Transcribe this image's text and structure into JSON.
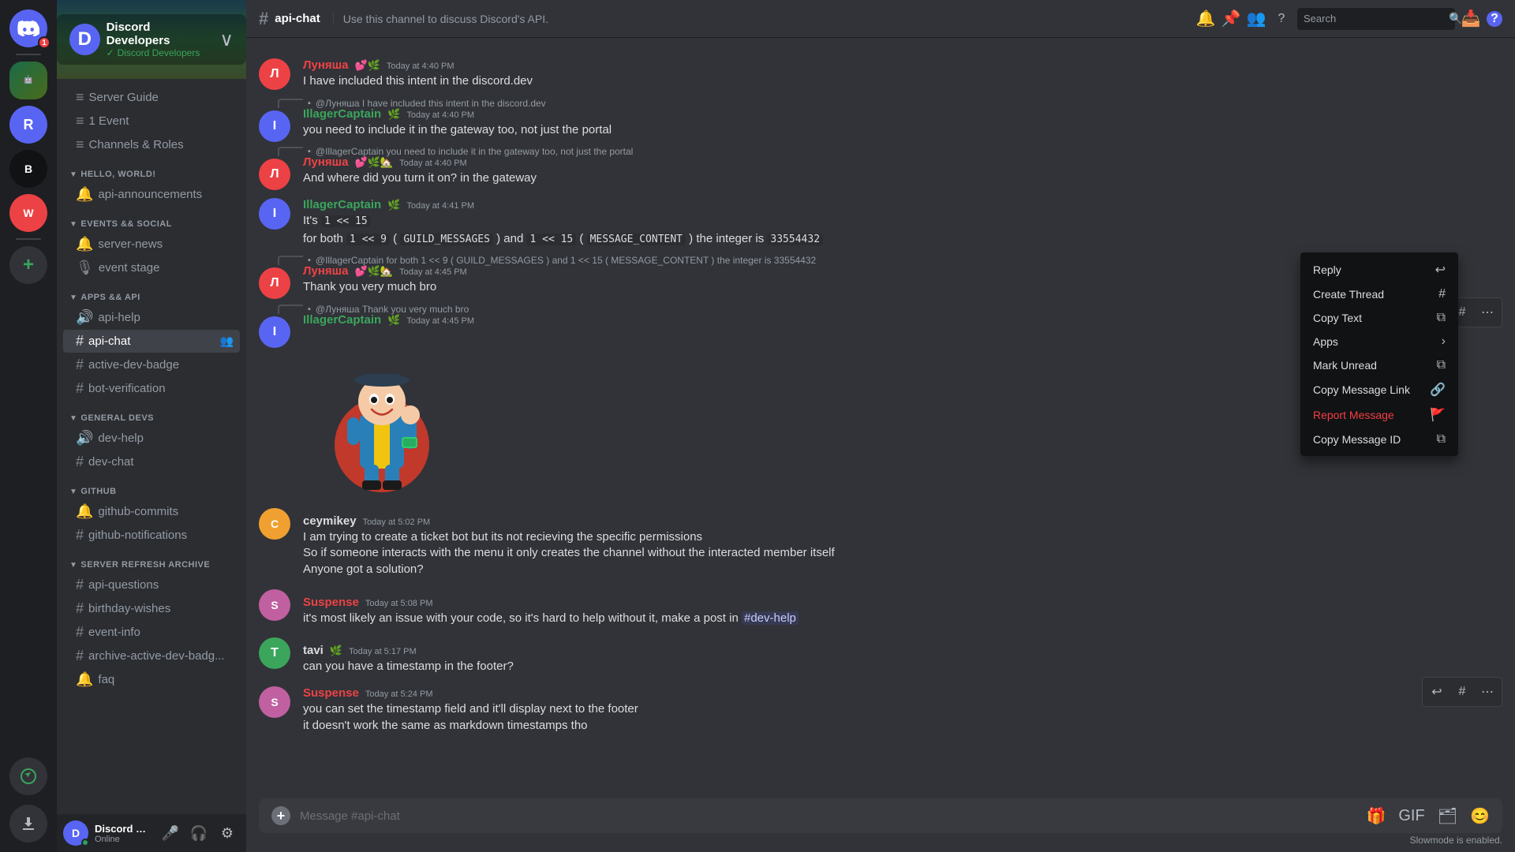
{
  "server": {
    "name": "Discord Developers",
    "banner_gradient": "linear-gradient(135deg, #5865f2, #3ba55c)"
  },
  "channel": {
    "name": "api-chat",
    "hash": "#",
    "topic": "Use this channel to discuss Discord's API.",
    "input_placeholder": "Message #api-chat"
  },
  "sidebar": {
    "categories": [
      {
        "name": "HELLO, WORLD!",
        "channels": [
          {
            "type": "announce",
            "name": "api-announcements",
            "active": false
          }
        ]
      },
      {
        "name": "EVENTS && SOCIAL",
        "channels": [
          {
            "type": "text",
            "name": "server-news",
            "active": false
          },
          {
            "type": "stage",
            "name": "event stage",
            "active": false
          }
        ]
      },
      {
        "name": "APPS && API",
        "channels": [
          {
            "type": "text",
            "name": "api-help",
            "active": false
          },
          {
            "type": "hash",
            "name": "api-chat",
            "active": true
          },
          {
            "type": "hash",
            "name": "active-dev-badge",
            "active": false
          },
          {
            "type": "hash",
            "name": "bot-verification",
            "active": false
          }
        ]
      },
      {
        "name": "GENERAL DEVS",
        "channels": [
          {
            "type": "text",
            "name": "dev-help",
            "active": false
          },
          {
            "type": "hash",
            "name": "dev-chat",
            "active": false
          }
        ]
      },
      {
        "name": "GITHUB",
        "channels": [
          {
            "type": "announce",
            "name": "github-commits",
            "active": false
          },
          {
            "type": "hash",
            "name": "github-notifications",
            "active": false
          }
        ]
      },
      {
        "name": "SERVER REFRESH ARCHIVE",
        "channels": [
          {
            "type": "hash",
            "name": "api-questions",
            "active": false
          },
          {
            "type": "hash",
            "name": "birthday-wishes",
            "active": false
          },
          {
            "type": "hash",
            "name": "event-info",
            "active": false
          },
          {
            "type": "hash",
            "name": "archive-active-dev-badg...",
            "active": false
          },
          {
            "type": "announce",
            "name": "faq",
            "active": false
          }
        ]
      }
    ]
  },
  "messages": [
    {
      "id": "msg1",
      "avatar_color": "#3ba55c",
      "avatar_letter": "Л",
      "author": "Луняша",
      "author_color": "#ed4245",
      "badges": "💕🌿",
      "timestamp": "Today at 4:40 PM",
      "content": "I have included this intent in the discord.dev",
      "has_reply": false
    },
    {
      "id": "msg2",
      "avatar_color": "#5865f2",
      "avatar_letter": "I",
      "author": "IllagerCaptain",
      "author_color": "#3ba55c",
      "badges": "🌿",
      "timestamp": "Today at 4:40 PM",
      "has_reply": true,
      "reply_to": "@Луняша",
      "reply_content": "I have included this intent in the discord.dev",
      "content": "you need to include it in the gateway too, not just the portal"
    },
    {
      "id": "msg3",
      "avatar_color": "#ed4245",
      "avatar_letter": "Л",
      "author": "Луняша",
      "author_color": "#ed4245",
      "badges": "💕🌿🏡",
      "timestamp": "Today at 4:40 PM",
      "has_reply": true,
      "reply_to": "@IllagerCaptain",
      "reply_content": "you need to include it in the gateway too, not just the portal",
      "content": "And where did you turn it on? in the gateway"
    },
    {
      "id": "msg4",
      "avatar_color": "#5865f2",
      "avatar_letter": "I",
      "author": "IllagerCaptain",
      "author_color": "#3ba55c",
      "badges": "🌿",
      "timestamp": "Today at 4:41 PM",
      "has_reply": false,
      "content": "It's  1 << 15",
      "content2": "for both  1 << 9 ( GUILD_MESSAGES ) and  1 << 15 ( MESSAGE_CONTENT ) the integer is  33554432",
      "has_image": false
    },
    {
      "id": "msg5",
      "avatar_color": "#ed4245",
      "avatar_letter": "Л",
      "author": "Луняша",
      "author_color": "#ed4245",
      "badges": "💕🌿🏡",
      "timestamp": "Today at 4:45 PM",
      "has_reply": true,
      "reply_to": "@IllagerCaptain",
      "reply_content": "for both  1 << 9 ( GUILD_MESSAGES ) and  1 << 15 ( MESSAGE_CONTENT ) the integer is  33554432",
      "content": "Thank you very much bro"
    },
    {
      "id": "msg6",
      "avatar_color": "#5865f2",
      "avatar_letter": "I",
      "author": "IllagerCaptain",
      "author_color": "#3ba55c",
      "badges": "🌿",
      "timestamp": "Today at 4:45 PM",
      "has_reply": true,
      "reply_to": "@Луняша",
      "reply_content": "Thank you very much bro",
      "content": "",
      "has_image": true
    },
    {
      "id": "msg7",
      "avatar_color": "#f0c060",
      "avatar_letter": "C",
      "author": "ceymikey",
      "author_color": "#dcddde",
      "badges": "",
      "timestamp": "Today at 5:02 PM",
      "has_reply": false,
      "content": "I am trying to create a ticket bot but its not recieving the specific permissions\nSo if someone interacts with the menu it only creates the channel without the interacted member itself\nAnyone got a solution?"
    },
    {
      "id": "msg8",
      "avatar_color": "#c060a0",
      "avatar_letter": "S",
      "author": "Suspense",
      "author_color": "#ed4245",
      "badges": "",
      "timestamp": "Today at 5:08 PM",
      "has_reply": false,
      "content": "it's most likely an issue with your code, so it's hard to help without it, make a post in #dev-help"
    },
    {
      "id": "msg9",
      "avatar_color": "#3ba55c",
      "avatar_letter": "T",
      "author": "tavi",
      "author_color": "#dcddde",
      "badges": "🌿",
      "timestamp": "Today at 5:17 PM",
      "has_reply": false,
      "content": "can you have a timestamp in the footer?"
    },
    {
      "id": "msg10",
      "avatar_color": "#c060a0",
      "avatar_letter": "S",
      "author": "Suspense",
      "author_color": "#ed4245",
      "badges": "",
      "timestamp": "Today at 5:24 PM",
      "has_reply": false,
      "content": "you can set the timestamp field and it'll display next to the footer\nit doesn't work the same as markdown timestamps tho"
    }
  ],
  "context_menu": {
    "items": [
      {
        "label": "Reply",
        "icon": "↩",
        "shortcut": "↩",
        "danger": false
      },
      {
        "label": "Create Thread",
        "icon": "#",
        "shortcut": "#",
        "danger": false
      },
      {
        "label": "Copy Text",
        "icon": "⧉",
        "shortcut": "⧉",
        "danger": false
      },
      {
        "label": "Apps",
        "icon": "›",
        "shortcut": "›",
        "danger": false
      },
      {
        "label": "Mark Unread",
        "icon": "⧉",
        "shortcut": "",
        "danger": false
      },
      {
        "label": "Copy Message Link",
        "icon": "🔗",
        "shortcut": "",
        "danger": false
      },
      {
        "label": "Report Message",
        "icon": "🚩",
        "shortcut": "",
        "danger": true
      },
      {
        "label": "Copy Message ID",
        "icon": "⧉",
        "shortcut": "",
        "danger": false
      }
    ]
  },
  "user": {
    "name": "Discord Pr...",
    "status": "Online",
    "avatar_color": "#5865f2",
    "avatar_letter": "D"
  },
  "footer": {
    "slowmode": "Slowmode is enabled."
  }
}
